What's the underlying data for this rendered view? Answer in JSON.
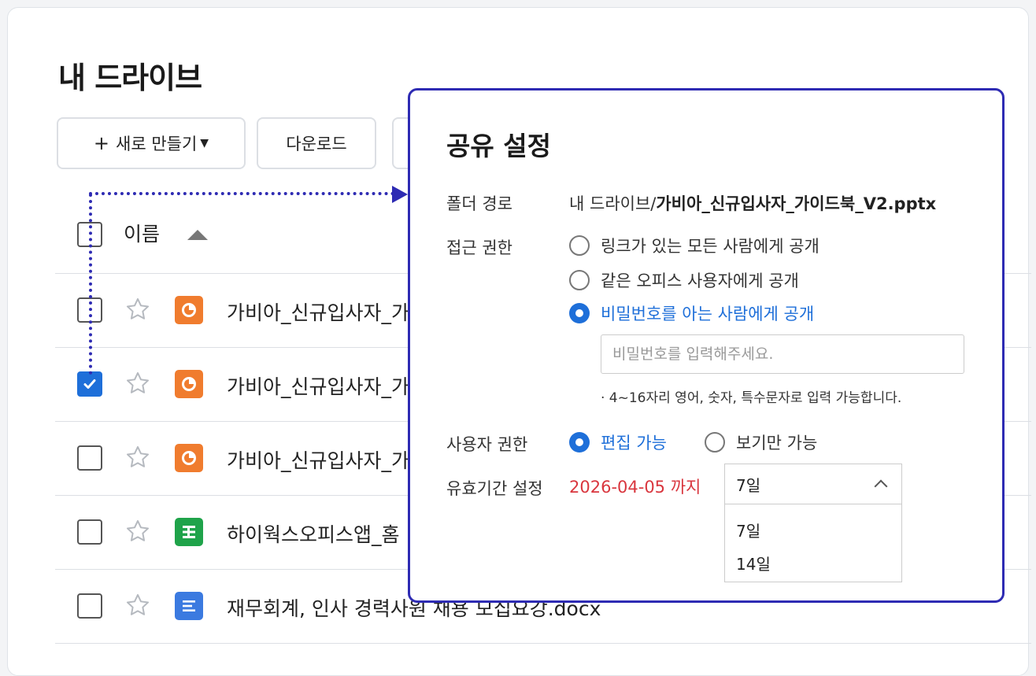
{
  "page": {
    "title": "내 드라이브"
  },
  "toolbar": {
    "new_label": "새로 만들기",
    "download_label": "다운로드"
  },
  "table": {
    "name_header": "이름"
  },
  "files": [
    {
      "name": "가비아_신규입사자_가",
      "type": "ppt",
      "checked": false
    },
    {
      "name": "가비아_신규입사자_가",
      "type": "ppt",
      "checked": true
    },
    {
      "name": "가비아_신규입사자_가",
      "type": "ppt",
      "checked": false
    },
    {
      "name": "하이웍스오피스앱_홈",
      "type": "sheet",
      "checked": false
    },
    {
      "name": "재무회계, 인사 경력사원 채용 모집요강.docx",
      "type": "doc",
      "checked": false
    }
  ],
  "dialog": {
    "title": "공유 설정",
    "path_label": "폴더 경로",
    "path_prefix": "내 드라이브/",
    "path_file": "가비아_신규입사자_가이드북_V2.pptx",
    "access_label": "접근 권한",
    "access_options": [
      "링크가 있는 모든 사람에게 공개",
      "같은 오피스 사용자에게 공개",
      "비밀번호를 아는 사람에게 공개"
    ],
    "access_selected": 2,
    "password_placeholder": "비밀번호를 입력해주세요.",
    "password_hint": "· 4~16자리 영어, 숫자, 특수문자로 입력 가능합니다.",
    "user_perm_label": "사용자 권한",
    "user_perm_options": [
      "편집 가능",
      "보기만 가능"
    ],
    "user_perm_selected": 0,
    "expiry_label": "유효기간 설정",
    "expiry_date": "2026-04-05 까지",
    "expiry_selected": "7일",
    "expiry_options": [
      "7일",
      "14일"
    ]
  },
  "colors": {
    "accent": "#1e6fd9",
    "highlight": "#2e2bb3",
    "date": "#d9363e"
  }
}
